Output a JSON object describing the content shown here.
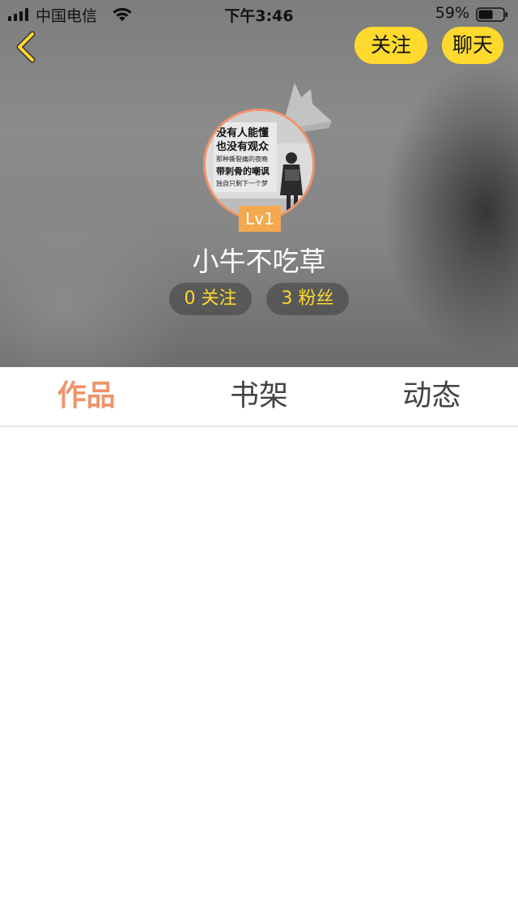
{
  "status_bar": {
    "carrier": "中国电信",
    "time": "下午3:46",
    "battery": "59%",
    "battery_level": 0.59
  },
  "header": {
    "follow_label": "关注",
    "chat_label": "聊天"
  },
  "profile": {
    "level": "Lv1",
    "username": "小牛不吃草",
    "following": "0 关注",
    "fans": "3 粉丝",
    "avatar_text": [
      "没有人能懂",
      "也没有观众",
      "那种撕裂痛的夜晚",
      "带刺骨的嘲讽",
      "独自只剩下一个梦"
    ]
  },
  "tabs": [
    {
      "label": "作品",
      "active": true
    },
    {
      "label": "书架",
      "active": false
    },
    {
      "label": "动态",
      "active": false
    }
  ],
  "colors": {
    "accent_yellow": "#ffd92e",
    "accent_orange": "#f0936a",
    "level_badge": "#f4a950"
  }
}
